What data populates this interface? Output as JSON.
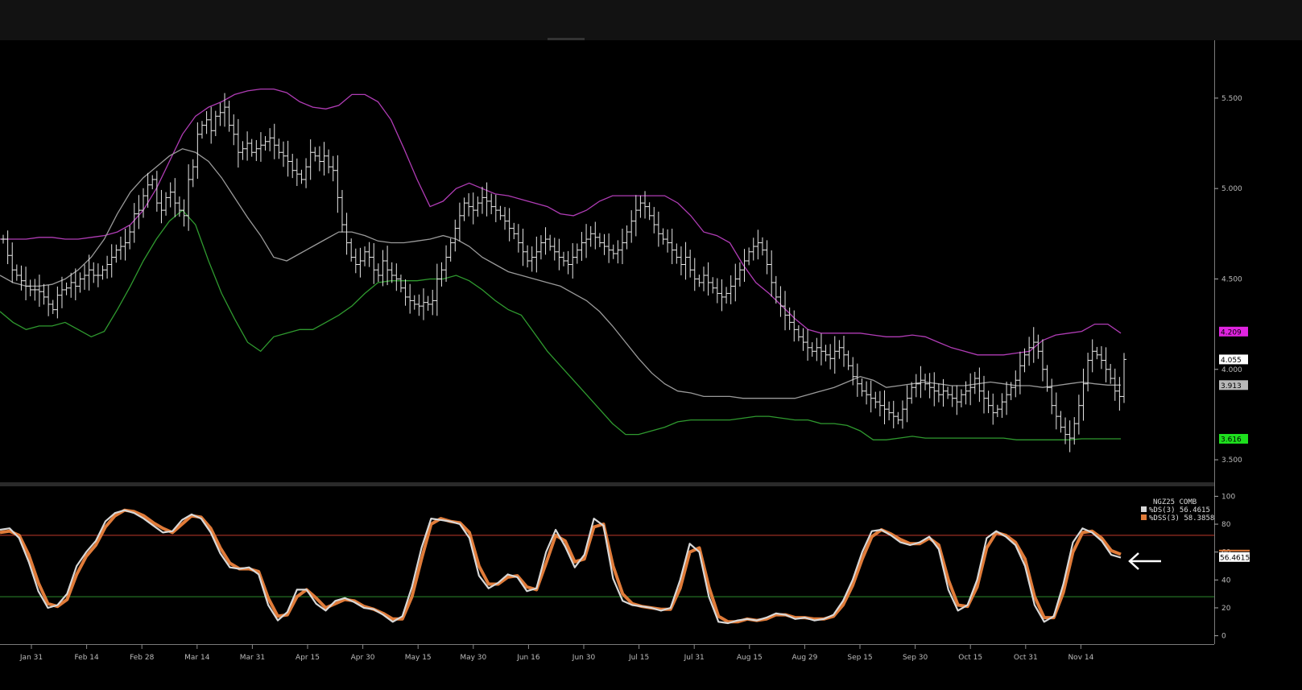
{
  "colors": {
    "background": "#000000",
    "bar": "#e6e6e6",
    "upper_band": "#b03cb5",
    "middle_band": "#9a9a9a",
    "lower_band": "#2f9a2f",
    "k_line": "#d8d8d8",
    "d_line": "#e07b39",
    "level_80": "#c0392b",
    "level_20": "#2e8b2e",
    "tag_upper": "#e024e0",
    "tag_last": "#ffffff",
    "tag_mid": "#b8b8b8",
    "tag_lower": "#1ee01e"
  },
  "chart_data": [
    {
      "type": "ohlc",
      "description_none": "",
      "x_ticks": [
        "Jan 31",
        "Feb 14",
        "Feb 28",
        "Mar 14",
        "Mar 31",
        "Apr 15",
        "Apr 30",
        "May 15",
        "May 30",
        "Jun 16",
        "Jun 30",
        "Jul 15",
        "Jul 31",
        "Aug 15",
        "Aug 29",
        "Sep 15",
        "Sep 30",
        "Oct 15",
        "Oct 31",
        "Nov 14"
      ],
      "y_ticks": [
        "5.500",
        "5.000",
        "4.500",
        "4.000",
        "3.500"
      ],
      "ylim": [
        3.38,
        5.82
      ],
      "close": [
        4.72,
        4.63,
        4.55,
        4.52,
        4.49,
        4.46,
        4.44,
        4.44,
        4.43,
        4.4,
        4.36,
        4.33,
        4.41,
        4.44,
        4.45,
        4.48,
        4.46,
        4.5,
        4.52,
        4.55,
        4.52,
        4.52,
        4.55,
        4.58,
        4.62,
        4.66,
        4.68,
        4.7,
        4.76,
        4.86,
        4.88,
        4.96,
        5.02,
        5.05,
        4.92,
        4.88,
        4.95,
        4.98,
        4.92,
        4.88,
        4.85,
        5.05,
        5.12,
        5.3,
        5.35,
        5.38,
        5.32,
        5.4,
        5.42,
        5.45,
        5.35,
        5.3,
        5.2,
        5.22,
        5.25,
        5.2,
        5.22,
        5.24,
        5.26,
        5.28,
        5.24,
        5.2,
        5.18,
        5.15,
        5.1,
        5.08,
        5.05,
        5.12,
        5.2,
        5.18,
        5.15,
        5.18,
        5.12,
        5.1,
        4.95,
        4.8,
        4.7,
        4.62,
        4.58,
        4.6,
        4.65,
        4.62,
        4.55,
        4.52,
        4.6,
        4.55,
        4.52,
        4.5,
        4.45,
        4.4,
        4.38,
        4.36,
        4.35,
        4.37,
        4.36,
        4.38,
        4.5,
        4.55,
        4.62,
        4.7,
        4.78,
        4.85,
        4.92,
        4.9,
        4.88,
        4.92,
        4.95,
        4.93,
        4.9,
        4.88,
        4.85,
        4.82,
        4.78,
        4.75,
        4.7,
        4.65,
        4.6,
        4.62,
        4.65,
        4.7,
        4.72,
        4.68,
        4.65,
        4.62,
        4.6,
        4.58,
        4.62,
        4.66,
        4.7,
        4.72,
        4.75,
        4.73,
        4.7,
        4.68,
        4.66,
        4.64,
        4.66,
        4.7,
        4.76,
        4.82,
        4.88,
        4.92,
        4.9,
        4.85,
        4.8,
        4.75,
        4.72,
        4.7,
        4.66,
        4.62,
        4.58,
        4.62,
        4.55,
        4.5,
        4.48,
        4.52,
        4.48,
        4.45,
        4.42,
        4.4,
        4.42,
        4.46,
        4.5,
        4.55,
        4.6,
        4.65,
        4.68,
        4.7,
        4.66,
        4.58,
        4.48,
        4.4,
        4.35,
        4.3,
        4.26,
        4.22,
        4.18,
        4.15,
        4.12,
        4.1,
        4.12,
        4.1,
        4.08,
        4.06,
        4.1,
        4.12,
        4.08,
        4.02,
        3.96,
        3.92,
        3.88,
        3.86,
        3.84,
        3.82,
        3.8,
        3.78,
        3.76,
        3.74,
        3.72,
        3.78,
        3.84,
        3.9,
        3.92,
        3.94,
        3.92,
        3.9,
        3.88,
        3.86,
        3.88,
        3.86,
        3.84,
        3.82,
        3.86,
        3.88,
        3.9,
        3.95,
        3.88,
        3.84,
        3.8,
        3.76,
        3.78,
        3.82,
        3.86,
        3.9,
        3.94,
        4.02,
        4.08,
        4.12,
        4.15,
        4.1,
        4.0,
        3.9,
        3.8,
        3.74,
        3.68,
        3.64,
        3.62,
        3.7,
        3.8,
        3.92,
        4.05,
        4.1,
        4.08,
        4.05,
        4.0,
        3.95,
        3.88,
        3.85,
        4.055
      ],
      "upper_band": [
        4.72,
        4.72,
        4.72,
        4.73,
        4.73,
        4.72,
        4.72,
        4.73,
        4.74,
        4.76,
        4.8,
        4.88,
        5.0,
        5.15,
        5.3,
        5.4,
        5.45,
        5.48,
        5.52,
        5.54,
        5.55,
        5.55,
        5.53,
        5.48,
        5.45,
        5.44,
        5.46,
        5.52,
        5.52,
        5.48,
        5.38,
        5.22,
        5.05,
        4.9,
        4.93,
        5.0,
        5.03,
        5.0,
        4.97,
        4.96,
        4.94,
        4.92,
        4.9,
        4.86,
        4.85,
        4.88,
        4.93,
        4.96,
        4.96,
        4.96,
        4.96,
        4.96,
        4.92,
        4.85,
        4.76,
        4.74,
        4.7,
        4.58,
        4.48,
        4.42,
        4.35,
        4.28,
        4.22,
        4.2,
        4.2,
        4.2,
        4.2,
        4.19,
        4.18,
        4.18,
        4.19,
        4.18,
        4.15,
        4.12,
        4.1,
        4.08,
        4.08,
        4.08,
        4.09,
        4.1,
        4.16,
        4.19,
        4.2,
        4.21,
        4.25,
        4.25,
        4.2
      ],
      "middle_band": [
        4.52,
        4.48,
        4.46,
        4.46,
        4.47,
        4.5,
        4.55,
        4.62,
        4.72,
        4.86,
        4.98,
        5.06,
        5.12,
        5.18,
        5.22,
        5.2,
        5.15,
        5.06,
        4.95,
        4.84,
        4.74,
        4.62,
        4.6,
        4.64,
        4.68,
        4.72,
        4.76,
        4.76,
        4.74,
        4.71,
        4.7,
        4.7,
        4.71,
        4.72,
        4.74,
        4.72,
        4.68,
        4.62,
        4.58,
        4.54,
        4.52,
        4.5,
        4.48,
        4.46,
        4.42,
        4.38,
        4.32,
        4.24,
        4.15,
        4.06,
        3.98,
        3.92,
        3.88,
        3.87,
        3.85,
        3.85,
        3.85,
        3.84,
        3.84,
        3.84,
        3.84,
        3.84,
        3.86,
        3.88,
        3.9,
        3.93,
        3.96,
        3.94,
        3.9,
        3.91,
        3.92,
        3.93,
        3.92,
        3.91,
        3.91,
        3.92,
        3.93,
        3.92,
        3.91,
        3.91,
        3.9,
        3.91,
        3.92,
        3.93,
        3.92,
        3.913,
        3.913
      ],
      "lower_band": [
        4.32,
        4.26,
        4.22,
        4.24,
        4.24,
        4.26,
        4.22,
        4.18,
        4.21,
        4.33,
        4.46,
        4.6,
        4.72,
        4.82,
        4.88,
        4.8,
        4.6,
        4.42,
        4.28,
        4.15,
        4.1,
        4.18,
        4.2,
        4.22,
        4.22,
        4.26,
        4.3,
        4.35,
        4.42,
        4.48,
        4.49,
        4.49,
        4.49,
        4.5,
        4.5,
        4.52,
        4.49,
        4.44,
        4.38,
        4.33,
        4.3,
        4.2,
        4.1,
        4.02,
        3.94,
        3.86,
        3.78,
        3.7,
        3.64,
        3.64,
        3.66,
        3.68,
        3.71,
        3.72,
        3.72,
        3.72,
        3.72,
        3.73,
        3.74,
        3.74,
        3.73,
        3.72,
        3.72,
        3.7,
        3.7,
        3.69,
        3.66,
        3.61,
        3.61,
        3.62,
        3.63,
        3.62,
        3.62,
        3.62,
        3.62,
        3.62,
        3.62,
        3.62,
        3.61,
        3.61,
        3.61,
        3.61,
        3.61,
        3.616,
        3.616,
        3.616,
        3.616
      ],
      "tags": [
        {
          "label": "4.209",
          "value": 4.209,
          "color_key": "tag_upper"
        },
        {
          "label": "4.055",
          "value": 4.055,
          "color_key": "tag_last"
        },
        {
          "label": "3.913",
          "value": 3.913,
          "color_key": "tag_mid"
        },
        {
          "label": "3.616",
          "value": 3.616,
          "color_key": "tag_lower"
        }
      ]
    },
    {
      "type": "line",
      "y_ticks": [
        "100",
        "80",
        "60",
        "40",
        "20",
        "0"
      ],
      "ylim": [
        -6,
        106
      ],
      "levels": [
        72,
        28
      ],
      "legend": {
        "title": "NGZ25 COMB",
        "entries": [
          {
            "label": "%DS(3)",
            "value": "56.4615",
            "color_key": "k_line"
          },
          {
            "label": "%DSS(3)",
            "value": "58.3858",
            "color_key": "d_line"
          }
        ]
      },
      "last_tag": "56.4615",
      "series": [
        {
          "name": "%DS(3)",
          "values": [
            76,
            77,
            70,
            53,
            32,
            20,
            22,
            30,
            50,
            60,
            68,
            82,
            88,
            90,
            88,
            84,
            79,
            74,
            75,
            83,
            87,
            84,
            74,
            59,
            49,
            48,
            49,
            44,
            22,
            11,
            17,
            33,
            33,
            23,
            18,
            25,
            27,
            24,
            20,
            19,
            15,
            10,
            14,
            35,
            63,
            84,
            83,
            82,
            80,
            70,
            43,
            34,
            38,
            44,
            42,
            32,
            34,
            60,
            76,
            64,
            49,
            58,
            84,
            79,
            41,
            25,
            22,
            21,
            20,
            18,
            20,
            40,
            66,
            60,
            28,
            10,
            9,
            11,
            12,
            11,
            13,
            16,
            15,
            12,
            13,
            11,
            12,
            15,
            25,
            40,
            60,
            75,
            76,
            72,
            67,
            65,
            67,
            71,
            62,
            33,
            18,
            22,
            40,
            70,
            75,
            71,
            65,
            50,
            22,
            10,
            14,
            37,
            67,
            77,
            74,
            68,
            58,
            56
          ]
        },
        {
          "name": "%DSS(3)",
          "values": [
            74,
            75,
            72,
            58,
            38,
            23,
            21,
            26,
            44,
            57,
            65,
            78,
            86,
            90,
            89,
            86,
            81,
            77,
            74,
            80,
            86,
            85,
            77,
            63,
            52,
            48,
            48,
            46,
            27,
            14,
            15,
            28,
            33,
            27,
            20,
            23,
            26,
            25,
            21,
            19,
            16,
            12,
            12,
            28,
            55,
            80,
            84,
            82,
            81,
            74,
            50,
            37,
            37,
            42,
            43,
            35,
            33,
            52,
            72,
            68,
            53,
            55,
            78,
            80,
            50,
            30,
            23,
            21,
            20,
            19,
            19,
            34,
            60,
            63,
            35,
            14,
            10,
            10,
            12,
            11,
            12,
            15,
            15,
            13,
            13,
            12,
            12,
            14,
            22,
            36,
            55,
            71,
            76,
            73,
            69,
            66,
            66,
            70,
            65,
            40,
            22,
            21,
            35,
            63,
            74,
            72,
            67,
            55,
            28,
            13,
            13,
            31,
            60,
            74,
            75,
            70,
            61,
            58.3858
          ]
        }
      ]
    }
  ]
}
